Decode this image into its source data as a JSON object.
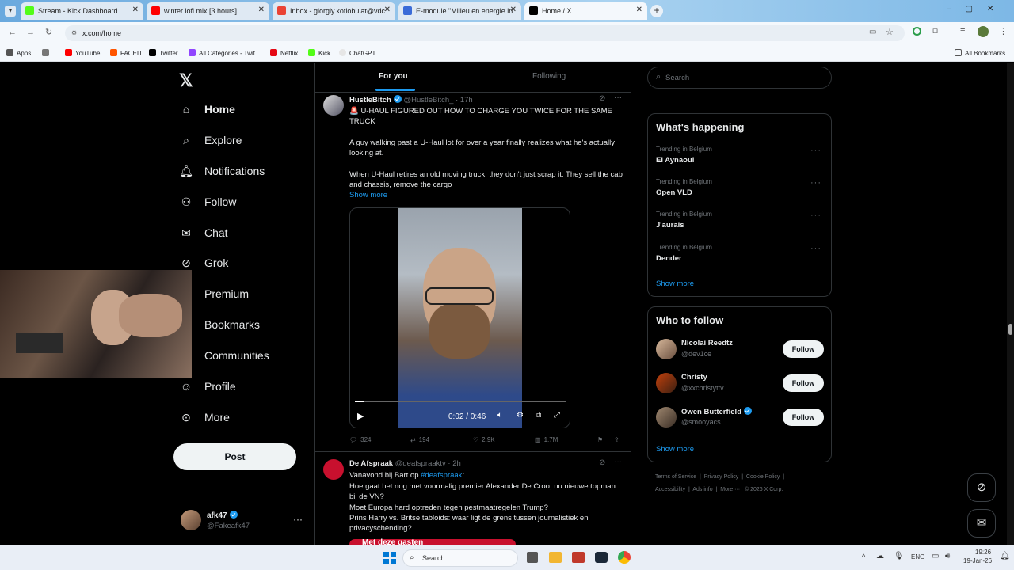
{
  "browser": {
    "tabs": [
      {
        "title": "Stream - Kick Dashboard",
        "color": "#53fc18"
      },
      {
        "title": "winter lofi mix [3 hours]",
        "color": "#ff0000"
      },
      {
        "title": "Inbox - giorgiy.kotlobulat@vdc",
        "color": "#ea4335"
      },
      {
        "title": "E-module \"Milieu en energie in",
        "color": "#3a6bd8"
      },
      {
        "title": "Home / X",
        "color": "#000000"
      }
    ],
    "url": "x.com/home",
    "bookmarks": [
      "Apps",
      "YouTube",
      "FACEIT",
      "Twitter",
      "All Categories - Twit...",
      "Netflix",
      "Kick",
      "ChatGPT"
    ],
    "all_bookmarks": "All Bookmarks"
  },
  "nav": {
    "items": [
      "Home",
      "Explore",
      "Notifications",
      "Follow",
      "Chat",
      "Grok",
      "Premium",
      "Bookmarks",
      "Communities",
      "Profile",
      "More"
    ],
    "post": "Post",
    "account_name": "afk47",
    "account_handle": "@Fakeafk47"
  },
  "feed": {
    "tabs": [
      "For you",
      "Following"
    ],
    "tweet1": {
      "author": "HustleBitch",
      "handle": "@HustleBitch_",
      "time": "· 17h",
      "line1": "🚨 U-HAUL FIGURED OUT HOW TO CHARGE YOU TWICE FOR THE SAME TRUCK",
      "line2": "A guy walking past a U-Haul lot for over a year finally realizes what he's actually looking at.",
      "line3": "When U-Haul retires an old moving truck, they don't just scrap it. They sell the cab and chassis, remove the cargo",
      "show_more": "Show more",
      "video_time": "0:02 / 0:46",
      "video_progress": 0.04,
      "replies": "324",
      "reposts": "194",
      "likes": "2.9K",
      "views": "1.7M"
    },
    "tweet2": {
      "author": "De Afspraak",
      "handle": "@deafspraaktv",
      "time": "· 2h",
      "line1a": "Vanavond bij Bart op ",
      "line1b": "#deafspraak",
      "line1c": ":",
      "line2": "Hoe gaat het nog met voormalig premier Alexander De Croo, nu nieuwe topman bij de VN?",
      "line3": "Moet Europa hard optreden tegen pestmaatregelen Trump?",
      "line4": "Prins Harry vs. Britse tabloids: waar ligt de grens tussen journalistiek en privacyschending?",
      "banner": "Met deze gasten"
    }
  },
  "sidebar": {
    "search_placeholder": "Search",
    "whats_happening": "What's happening",
    "trends": [
      {
        "context": "Trending in Belgium",
        "name": "El Aynaoui"
      },
      {
        "context": "Trending in Belgium",
        "name": "Open VLD"
      },
      {
        "context": "Trending in Belgium",
        "name": "J'aurais"
      },
      {
        "context": "Trending in Belgium",
        "name": "Dender"
      }
    ],
    "show_more": "Show more",
    "who_to_follow": "Who to follow",
    "people": [
      {
        "name": "Nicolai Reedtz",
        "handle": "@dev1ce",
        "button": "Follow",
        "verified": false
      },
      {
        "name": "Christy",
        "handle": "@xxchristyttv",
        "button": "Follow",
        "verified": false
      },
      {
        "name": "Owen Butterfield",
        "handle": "@smooyacs",
        "button": "Follow",
        "verified": true
      }
    ],
    "show_more2": "Show more",
    "footer1": [
      "Terms of Service",
      "Privacy Policy",
      "Cookie Policy"
    ],
    "footer2": [
      "Accessibility",
      "Ads info",
      "More ···",
      "© 2026 X Corp."
    ]
  },
  "taskbar": {
    "search": "Search",
    "lang": "ENG",
    "time": "19:26",
    "date": "19-Jan-26"
  }
}
